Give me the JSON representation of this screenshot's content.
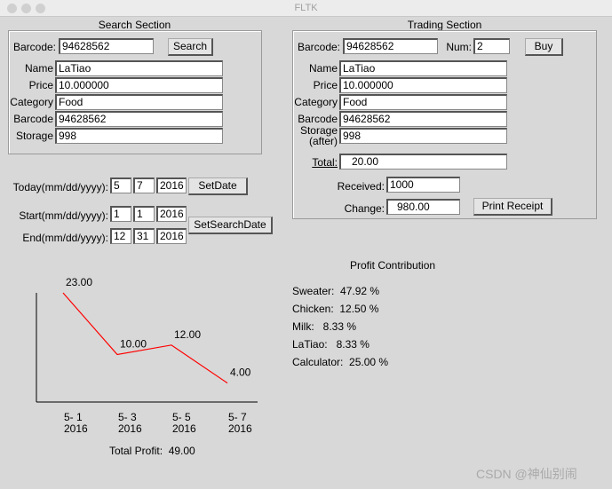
{
  "window": {
    "title": "FLTK"
  },
  "search": {
    "title": "Search Section",
    "barcode_label": "Barcode:",
    "barcode": "94628562",
    "search_label": "Search",
    "fields": [
      {
        "label": "Name",
        "value": "LaTiao"
      },
      {
        "label": "Price",
        "value": "10.000000"
      },
      {
        "label": "Category",
        "value": "Food"
      },
      {
        "label": "Barcode",
        "value": "94628562"
      },
      {
        "label": "Storage",
        "value": "998"
      }
    ]
  },
  "dates": {
    "today_label": "Today(mm/dd/yyyy):",
    "today": [
      "5",
      "7",
      "2016"
    ],
    "setdate_label": "SetDate",
    "start_label": "Start(mm/dd/yyyy):",
    "start": [
      "1",
      "1",
      "2016"
    ],
    "end_label": "End(mm/dd/yyyy):",
    "end": [
      "12",
      "31",
      "2016"
    ],
    "setsearch_label": "SetSearchDate"
  },
  "trading": {
    "title": "Trading Section",
    "barcode_label": "Barcode:",
    "barcode": "94628562",
    "num_label": "Num:",
    "num": "2",
    "buy_label": "Buy",
    "fields": [
      {
        "label": "Name",
        "value": "LaTiao"
      },
      {
        "label": "Price",
        "value": "10.000000"
      },
      {
        "label": "Category",
        "value": "Food"
      },
      {
        "label": "Barcode",
        "value": "94628562"
      }
    ],
    "storage_label1": "Storage",
    "storage_label2": "(after)",
    "storage": "998",
    "total_label": "Total:",
    "total": "20.00",
    "received_label": "Received:",
    "received": "1000",
    "change_label": "Change:",
    "change": "980.00",
    "print_label": "Print Receipt"
  },
  "profit": {
    "title": "Profit Contribution",
    "items": [
      "Sweater:  47.92 %",
      "Chicken:  12.50 %",
      "Milk:   8.33 %",
      "LaTiao:   8.33 %",
      "Calculator:  25.00 %"
    ]
  },
  "chart_data": {
    "type": "line",
    "categories": [
      "5- 1\n2016",
      "5- 3\n2016",
      "5- 5\n2016",
      "5- 7\n2016"
    ],
    "cat_line1": [
      "5- 1",
      "5- 3",
      "5- 5",
      "5- 7"
    ],
    "cat_line2": [
      "2016",
      "2016",
      "2016",
      "2016"
    ],
    "values": [
      23,
      10,
      12,
      4
    ],
    "data_labels": [
      "23.00",
      "10.00",
      "12.00",
      "4.00"
    ],
    "ylim": [
      0,
      23
    ],
    "line_color": "#ff0000",
    "total_label": "Total Profit:  49.00"
  },
  "watermark": "CSDN @神仙别闹"
}
